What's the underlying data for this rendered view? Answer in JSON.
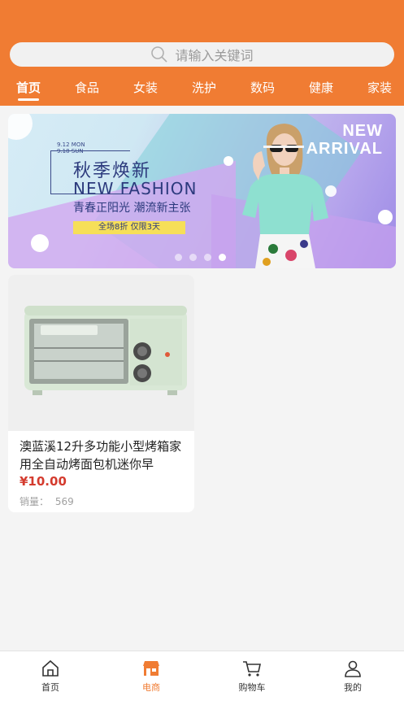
{
  "search": {
    "placeholder": "请输入关键词",
    "icon": "search-icon"
  },
  "tabs": [
    {
      "label": "首页",
      "active": true
    },
    {
      "label": "食品",
      "active": false
    },
    {
      "label": "女装",
      "active": false
    },
    {
      "label": "洗护",
      "active": false
    },
    {
      "label": "数码",
      "active": false
    },
    {
      "label": "健康",
      "active": false
    },
    {
      "label": "家装",
      "active": false
    }
  ],
  "banner": {
    "date_line1": "9.12 MON",
    "date_line2": "9.18 SUN",
    "title": "秋季焕新",
    "subtitle": "NEW FASHION",
    "slogan": "青春正阳光 潮流新主张",
    "promo": "全场8折  仅限3天",
    "new_arrival_line1": "NEW",
    "new_arrival_line2": "ARRIVAL",
    "slides": 4,
    "active_slide": 4
  },
  "product": {
    "title": "澳蓝溪12升多功能小型烤箱家用全自动烤面包机迷你早",
    "price": "¥10.00",
    "sales_label": "销量：",
    "sales_value": "569"
  },
  "tabbar": [
    {
      "label": "首页",
      "icon": "home-icon",
      "active": false
    },
    {
      "label": "电商",
      "icon": "shop-icon",
      "active": true
    },
    {
      "label": "购物车",
      "icon": "cart-icon",
      "active": false
    },
    {
      "label": "我的",
      "icon": "user-icon",
      "active": false
    }
  ],
  "colors": {
    "accent": "#f07c33",
    "price": "#d43b2e"
  }
}
